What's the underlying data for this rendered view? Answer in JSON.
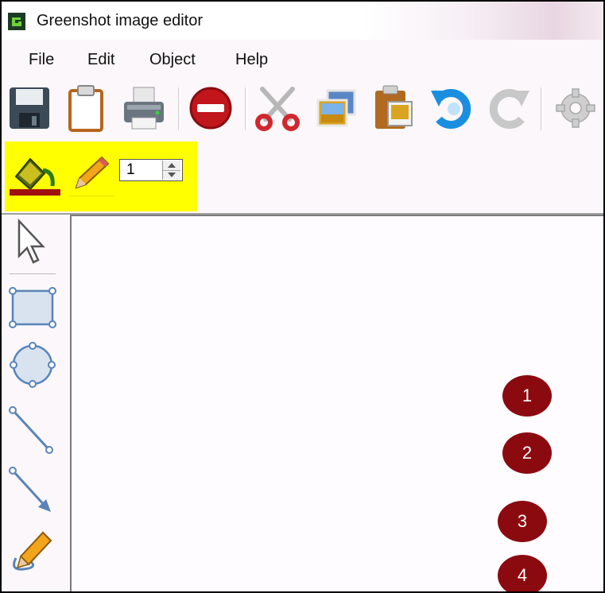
{
  "window": {
    "title": "Greenshot image editor",
    "app_icon": "greenshot-icon"
  },
  "menu": {
    "items": [
      "File",
      "Edit",
      "Object",
      "Help"
    ]
  },
  "toolbar": {
    "buttons": [
      "save-icon",
      "copy-to-clipboard-icon",
      "print-icon",
      "delete-icon",
      "cut-icon",
      "copy-image-icon",
      "paste-icon",
      "undo-icon",
      "redo-icon",
      "settings-icon"
    ]
  },
  "properties": {
    "highlight_color": "#ffff00",
    "fill_color": "#a01010",
    "line_color": "#ffff00",
    "line_thickness": "1"
  },
  "tools": [
    "cursor-icon",
    "rectangle-icon",
    "ellipse-icon",
    "line-icon",
    "arrow-icon",
    "freehand-icon"
  ],
  "canvas": {
    "badges": [
      "1",
      "2",
      "3",
      "4"
    ],
    "badge_color": "#8b0a10"
  }
}
